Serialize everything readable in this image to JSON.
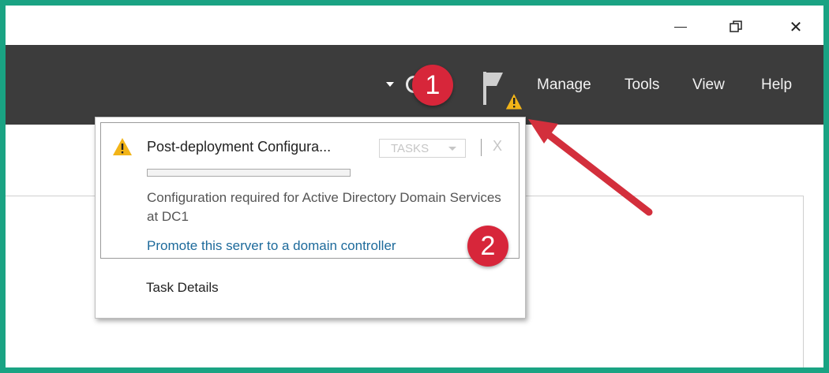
{
  "window": {
    "minimize_glyph": "—",
    "close_glyph": "✕"
  },
  "menubar": {
    "items": [
      {
        "label": "Manage"
      },
      {
        "label": "Tools"
      },
      {
        "label": "View"
      },
      {
        "label": "Help"
      }
    ]
  },
  "callouts": {
    "badge1": "1",
    "badge2": "2"
  },
  "notification": {
    "title": "Post-deployment Configura...",
    "tasks_label": "TASKS",
    "close_glyph": "X",
    "progress": 0,
    "description": "Configuration required for Active Directory Domain Services at DC1",
    "link": "Promote this server to a domain controller"
  },
  "popup": {
    "task_details": "Task Details"
  },
  "colors": {
    "frame": "#1aa383",
    "menubar": "#3c3c3c",
    "badge": "#d7263a",
    "arrow": "#d32f3c",
    "warning": "#f2b418",
    "link": "#1d6a9b"
  },
  "icons": [
    "minimize-icon",
    "restore-icon",
    "close-icon",
    "refresh-icon",
    "notification-flag-icon",
    "warning-icon",
    "pointer-arrow"
  ]
}
